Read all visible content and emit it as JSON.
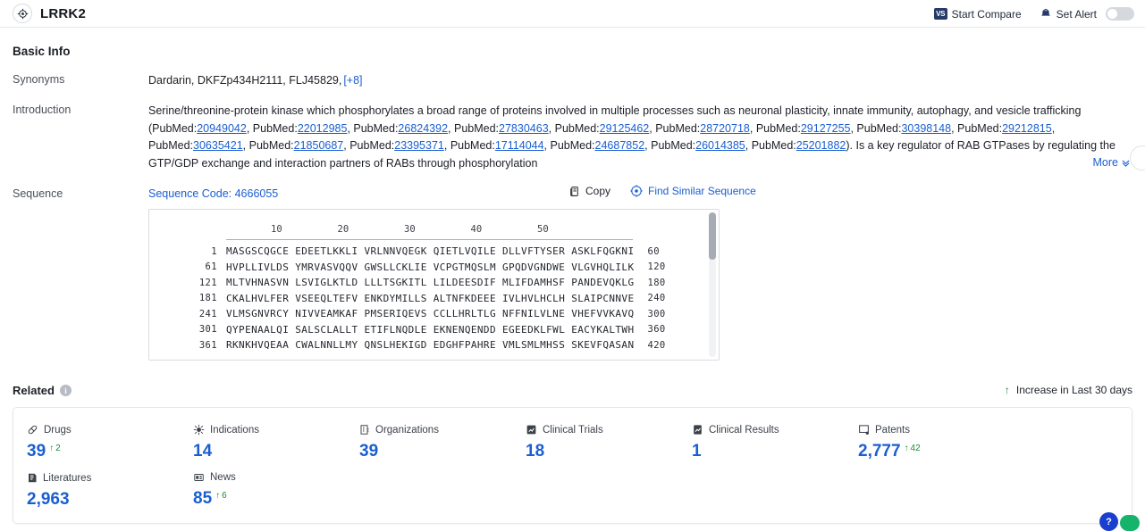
{
  "header": {
    "title": "LRRK2",
    "brand_icon": "target-icon",
    "actions": [
      {
        "label": "Start Compare",
        "icon": "vs-badge-icon",
        "badge": "VS"
      },
      {
        "label": "Set Alert",
        "icon": "alert-bell-icon",
        "toggle_state": "off"
      }
    ]
  },
  "basic_info": {
    "title": "Basic Info",
    "synonyms": {
      "label": "Synonyms",
      "values": "Dardarin,  DKFZp434H2111,  FLJ45829,",
      "more": "[+8]"
    },
    "introduction": {
      "label": "Introduction",
      "text_part1": "Serine/threonine-protein kinase which phosphorylates a broad range of proteins involved in multiple processes such as neuronal plasticity, innate immunity, autophagy, and vesicle trafficking (PubMed:",
      "pmids_line1": [
        "20949042"
      ],
      "pmid_prefix": "PubMed:",
      "pmids_line2": [
        "22012985",
        "26824392",
        "27830463",
        "29125462",
        "28720718",
        "29127255",
        "30398148",
        "29212815",
        "30635421",
        "21850687",
        "23395371"
      ],
      "pmids_line3": [
        "17114044",
        "24687852",
        "26014385",
        "25201882"
      ],
      "text_part2": "). Is a key regulator of RAB GTPases by regulating the GTP/GDP exchange and interaction partners of RABs through phosphorylation",
      "more_label": "More",
      "more_icon": "chevron-double-down-icon"
    }
  },
  "sequence": {
    "label": "Sequence",
    "code_label": "Sequence Code: 4666055",
    "copy_label": "Copy",
    "copy_icon": "copy-icon",
    "find_similar_label": "Find Similar Sequence",
    "find_similar_icon": "target-icon",
    "ruler_ticks": [
      "10",
      "20",
      "30",
      "40",
      "50"
    ],
    "lines": [
      {
        "start": "1",
        "chunks": "MASGSCQGCE EDEETLKKLI VRLNNVQEGK QIETLVQILE DLLVFTYSER ASKLFQGKNI",
        "end": "60"
      },
      {
        "start": "61",
        "chunks": "HVPLLIVLDS YMRVASVQQV GWSLLCKLIE VCPGTMQSLM GPQDVGNDWE VLGVHQLILK",
        "end": "120"
      },
      {
        "start": "121",
        "chunks": "MLTVHNASVN LSVIGLKTLD LLLTSGKITL LILDEESDIF MLIFDAMHSF PANDEVQKLG",
        "end": "180"
      },
      {
        "start": "181",
        "chunks": "CKALHVLFER VSEEQLTEFV ENKDYMILLS ALTNFKDEEE IVLHVLHCLH SLAIPCNNVE",
        "end": "240"
      },
      {
        "start": "241",
        "chunks": "VLMSGNVRCY NIVVEAMKAF PMSERIQEVS CCLLHRLTLG NFFNILVLNE VHEFVVKAVQ",
        "end": "300"
      },
      {
        "start": "301",
        "chunks": "QYPENAALQI SALSCLALLT ETIFLNQDLE EKNENQENDD EGEEDKLFWL EACYKALTWH",
        "end": "360"
      },
      {
        "start": "361",
        "chunks": "RKNKHVQEAA CWALNNLLMY QNSLHEKIGD EDGHFPAHRE VMLSMLMHSS SKEVFQASAN",
        "end": "420"
      }
    ]
  },
  "related": {
    "title": "Related",
    "info_icon": "info-icon",
    "legend_label": "Increase in Last 30 days",
    "legend_icon": "arrow-up-icon",
    "stats": [
      {
        "label": "Drugs",
        "icon": "pill-icon",
        "value": "39",
        "delta": "2"
      },
      {
        "label": "Indications",
        "icon": "virus-icon",
        "value": "14",
        "delta": ""
      },
      {
        "label": "Organizations",
        "icon": "building-icon",
        "value": "39",
        "delta": ""
      },
      {
        "label": "Clinical Trials",
        "icon": "clinical-trial-icon",
        "value": "18",
        "delta": ""
      },
      {
        "label": "Clinical Results",
        "icon": "clinical-result-icon",
        "value": "1",
        "delta": ""
      },
      {
        "label": "Patents",
        "icon": "patent-icon",
        "value": "2,777",
        "delta": "42"
      },
      {
        "label": "Literatures",
        "icon": "book-icon",
        "value": "2,963",
        "delta": ""
      },
      {
        "label": "News",
        "icon": "news-icon",
        "value": "85",
        "delta": "6"
      }
    ]
  },
  "floating": {
    "help_label": "?",
    "help_icon": "question-icon",
    "chat_icon": "chat-icon"
  },
  "colors": {
    "link": "#1a5fd0",
    "increase": "#1a8a3c",
    "brand_dark": "#253a66"
  }
}
